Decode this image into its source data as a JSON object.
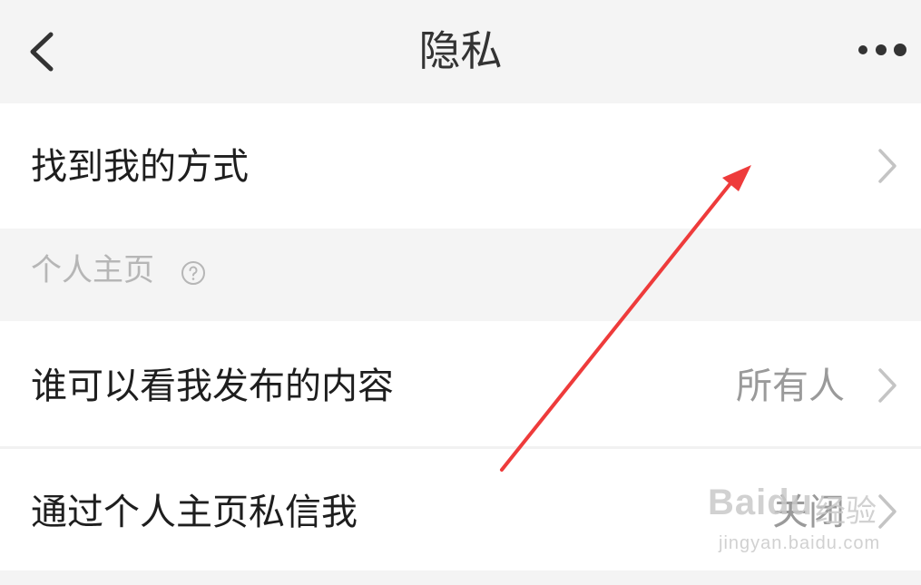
{
  "nav": {
    "title": "隐私",
    "back_icon": "chevron-left-icon",
    "more_icon": "more-dots-icon"
  },
  "rows": [
    {
      "label": "找到我的方式",
      "value": "",
      "icon": "chevron-right-icon"
    },
    {
      "label": "谁可以看我发布的内容",
      "value": "所有人",
      "icon": "chevron-right-icon"
    },
    {
      "label": "通过个人主页私信我",
      "value": "关闭",
      "icon": "chevron-right-icon"
    }
  ],
  "section": {
    "label": "个人主页",
    "help_icon": "question-circle-icon"
  },
  "watermark": {
    "brand": "Baidu",
    "product": "经验",
    "url": "jingyan.baidu.com"
  },
  "colors": {
    "background": "#f4f4f4",
    "row_background": "#ffffff",
    "text_primary": "#1e1e1e",
    "text_secondary": "#9a9a9a",
    "section_text": "#b6b6b6",
    "chevron": "#c4c4c4",
    "annotation_arrow": "#ee3b3b"
  }
}
